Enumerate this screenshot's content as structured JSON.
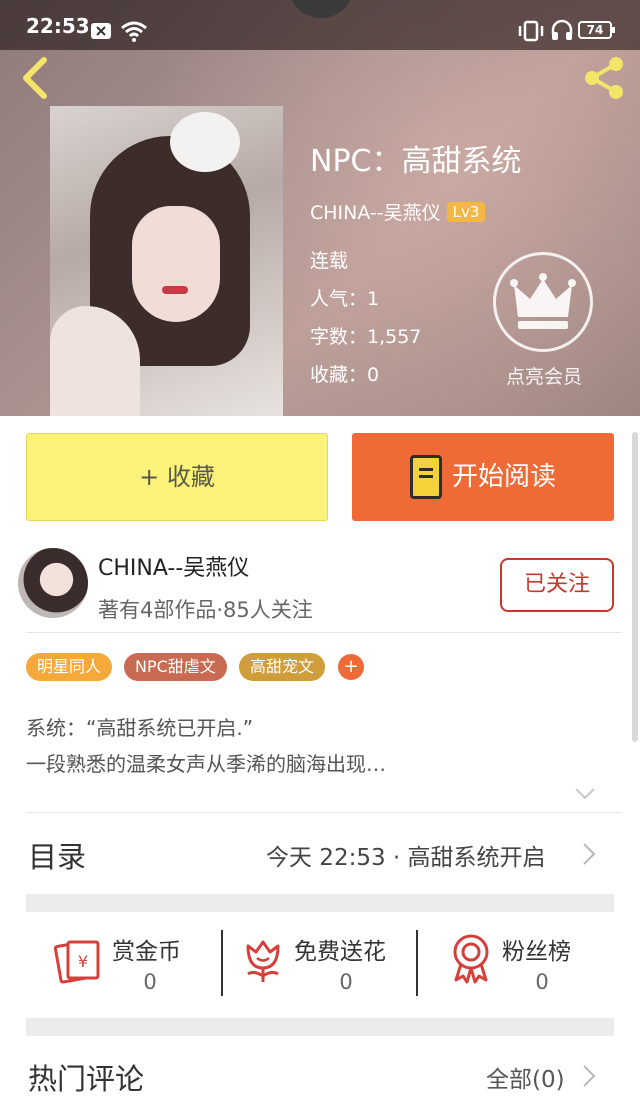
{
  "status_bar": {
    "time": "22:53",
    "battery": "74"
  },
  "book": {
    "title": "NPC：高甜系统",
    "author": "CHINA--吴燕仪",
    "level": "Lv3",
    "status": "连载",
    "popularity": "人气：1",
    "word_count": "字数：1,557",
    "favorites": "收藏：0",
    "vip_label": "点亮会员"
  },
  "actions": {
    "collect_label": "+ 收藏",
    "read_label": "开始阅读"
  },
  "author_card": {
    "name": "CHINA--吴燕仪",
    "stats": "著有4部作品·85人关注",
    "follow_label": "已关注"
  },
  "tags": [
    {
      "label": "明星同人",
      "color": "#f5a93a"
    },
    {
      "label": "NPC甜虐文",
      "color": "#c96b52"
    },
    {
      "label": "高甜宠文",
      "color": "#cf9d3a"
    }
  ],
  "synopsis": {
    "line1": "系统：“高甜系统已开启.”",
    "line2": "一段熟悉的温柔女声从季浠的脑海出现…"
  },
  "catalog": {
    "label": "目录",
    "latest": "今天 22:53 · 高甜系统开启"
  },
  "stats": [
    {
      "label": "赏金币",
      "value": "0",
      "icon": "red-envelope-icon"
    },
    {
      "label": "免费送花",
      "value": "0",
      "icon": "flower-icon"
    },
    {
      "label": "粉丝榜",
      "value": "0",
      "icon": "medal-icon"
    }
  ],
  "comments": {
    "label": "热门评论",
    "all_label": "全部(0)"
  },
  "colors": {
    "accent": "#ee6a36",
    "collect": "#fbf27a",
    "follow": "#c8382a",
    "icon_red": "#d6403a"
  }
}
